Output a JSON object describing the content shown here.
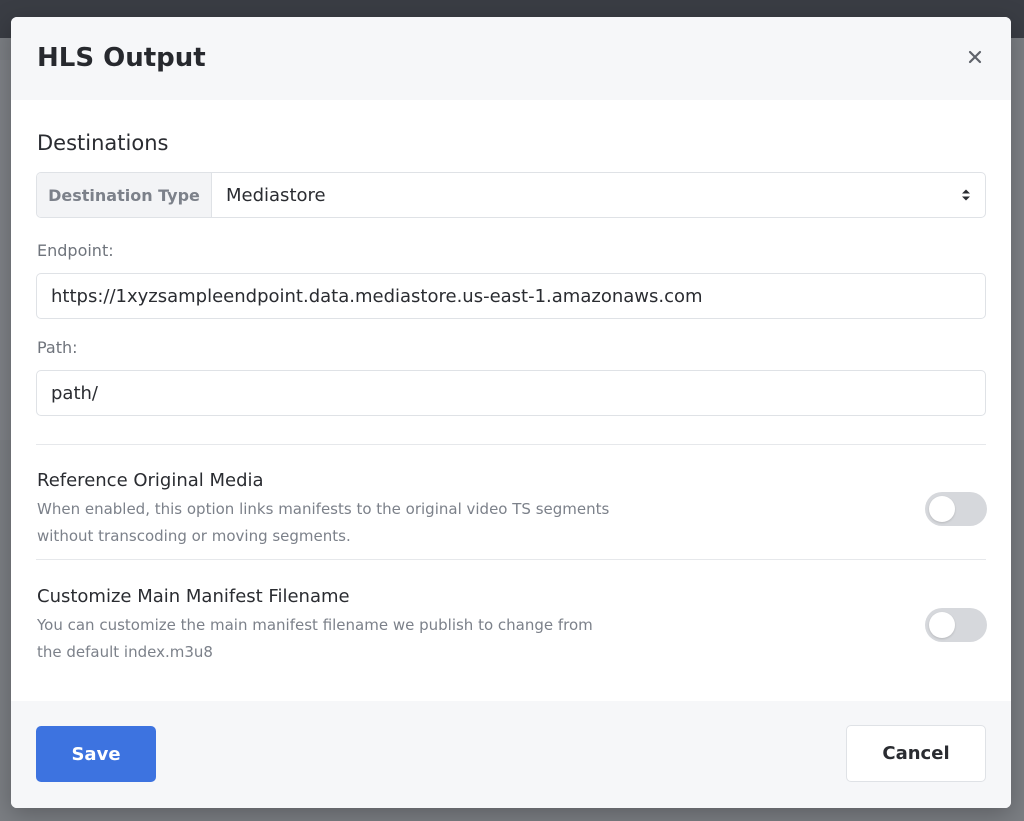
{
  "modal": {
    "title": "HLS Output",
    "close_icon": "close-icon"
  },
  "destinations": {
    "section_title": "Destinations",
    "destination_type_label": "Destination Type",
    "destination_type_value": "Mediastore",
    "endpoint_label": "Endpoint:",
    "endpoint_value": "https://1xyzsampleendpoint.data.mediastore.us-east-1.amazonaws.com",
    "path_label": "Path:",
    "path_value": "path/"
  },
  "options": [
    {
      "title": "Reference Original Media",
      "description": "When enabled, this option links manifests to the original video TS segments without transcoding or moving segments.",
      "enabled": false
    },
    {
      "title": "Customize Main Manifest Filename",
      "description": "You can customize the main manifest filename we publish to change from the default index.m3u8",
      "enabled": false
    }
  ],
  "footer": {
    "save_label": "Save",
    "cancel_label": "Cancel"
  },
  "colors": {
    "primary": "#3d73e0",
    "toggle_off": "#d6d8dc",
    "overlay": "#7b7e83"
  }
}
